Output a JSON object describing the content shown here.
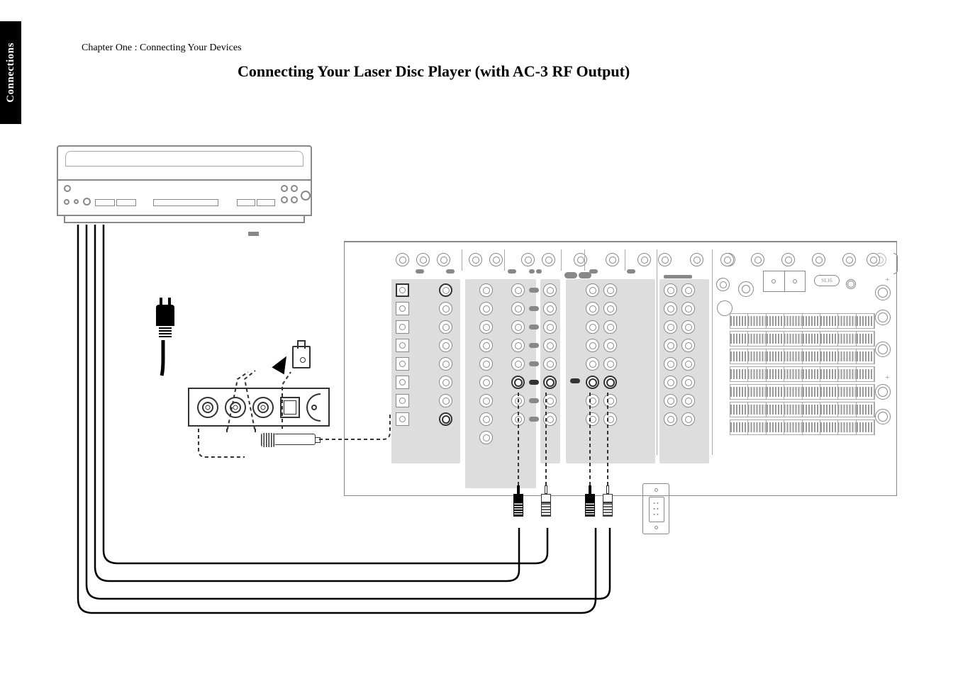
{
  "side_tab": "Connections",
  "chapter_header": "Chapter One : Connecting Your Devices",
  "page_title": "Connecting Your Laser Disc Player (with AC-3 RF Output)"
}
